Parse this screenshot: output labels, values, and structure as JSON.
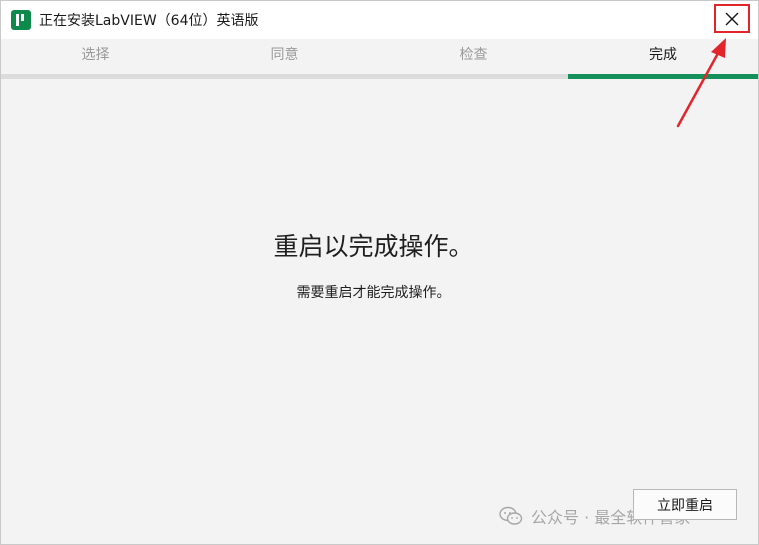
{
  "window": {
    "title": "正在安装LabVIEW（64位）英语版",
    "logo_icon": "labview-logo-icon",
    "close_icon": "close-icon"
  },
  "tabs": [
    {
      "label": "选择",
      "active": false
    },
    {
      "label": "同意",
      "active": false
    },
    {
      "label": "检查",
      "active": false
    },
    {
      "label": "完成",
      "active": true
    }
  ],
  "content": {
    "headline": "重启以完成操作。",
    "subtext": "需要重启才能完成操作。"
  },
  "actions": {
    "restart_label": "立即重启"
  },
  "watermark": {
    "text": "公众号 · 最全软件管家",
    "icon": "wechat-icon"
  },
  "colors": {
    "accent": "#14905a",
    "annotation": "#e0262b"
  }
}
